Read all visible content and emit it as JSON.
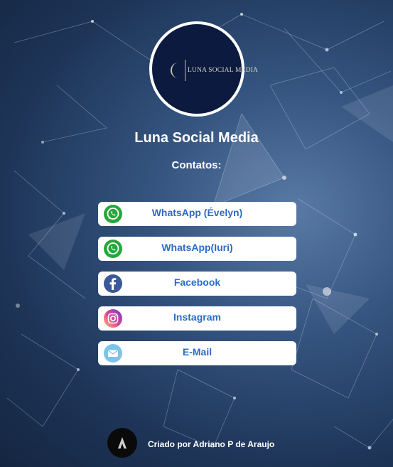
{
  "profile": {
    "logo_text": "LUNA SOCIAL MEDIA",
    "name": "Luna Social Media",
    "contacts_heading": "Contatos:"
  },
  "links": [
    {
      "label": "WhatsApp (Évelyn)",
      "icon": "whatsapp-icon",
      "color": "#25a83b"
    },
    {
      "label": "WhatsApp(Iuri)",
      "icon": "whatsapp-icon",
      "color": "#25a83b"
    },
    {
      "label": "Facebook",
      "icon": "facebook-icon",
      "color": "#3b5998"
    },
    {
      "label": "Instagram",
      "icon": "instagram-icon",
      "color": "#e1306c"
    },
    {
      "label": "E-Mail",
      "icon": "email-icon",
      "color": "#7cc4ea"
    }
  ],
  "footer": {
    "credit": "Criado por Adriano P de Araujo",
    "avatar_letter": "A"
  },
  "colors": {
    "background": "#34547f",
    "link_text": "#2b6cc4",
    "logo_bg": "#0b1a3e"
  }
}
